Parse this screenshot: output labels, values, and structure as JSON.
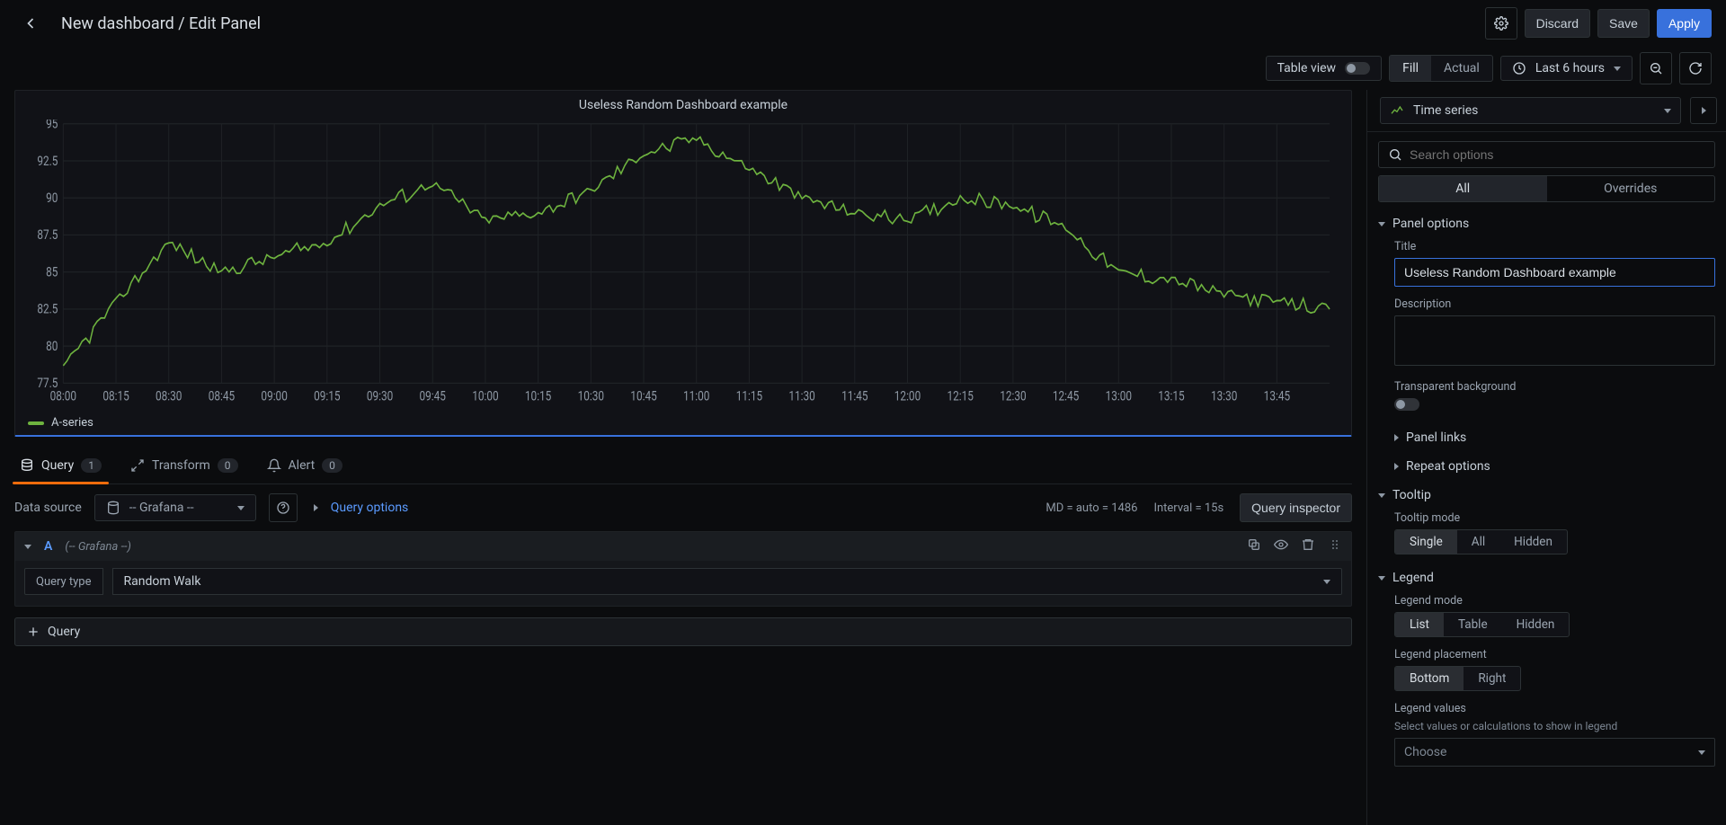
{
  "header": {
    "breadcrumb": "New dashboard / Edit Panel",
    "discard": "Discard",
    "save": "Save",
    "apply": "Apply"
  },
  "toolbar": {
    "table_view": "Table view",
    "fill": "Fill",
    "actual": "Actual",
    "time_range": "Last 6 hours"
  },
  "viz_picker": {
    "current": "Time series"
  },
  "chart": {
    "title": "Useless Random Dashboard example",
    "legend_series": "A-series"
  },
  "tabs": {
    "query": "Query",
    "query_count": "1",
    "transform": "Transform",
    "transform_count": "0",
    "alert": "Alert",
    "alert_count": "0"
  },
  "query": {
    "data_source_label": "Data source",
    "data_source_value": "-- Grafana --",
    "query_options": "Query options",
    "md": "MD = auto = 1486",
    "interval": "Interval = 15s",
    "inspector": "Query inspector",
    "row_letter": "A",
    "row_ds": "(-- Grafana --)",
    "query_type_label": "Query type",
    "query_type_value": "Random Walk",
    "add_query": "Query"
  },
  "side": {
    "search_placeholder": "Search options",
    "tab_all": "All",
    "tab_overrides": "Overrides",
    "panel_options": "Panel options",
    "title_label": "Title",
    "title_value": "Useless Random Dashboard example",
    "description_label": "Description",
    "transparent_label": "Transparent background",
    "panel_links": "Panel links",
    "repeat_options": "Repeat options",
    "tooltip": "Tooltip",
    "tooltip_mode_label": "Tooltip mode",
    "tooltip_mode": {
      "single": "Single",
      "all": "All",
      "hidden": "Hidden"
    },
    "legend": "Legend",
    "legend_mode_label": "Legend mode",
    "legend_mode": {
      "list": "List",
      "table": "Table",
      "hidden": "Hidden"
    },
    "legend_placement_label": "Legend placement",
    "legend_placement": {
      "bottom": "Bottom",
      "right": "Right"
    },
    "legend_values_label": "Legend values",
    "legend_values_hint": "Select values or calculations to show in legend",
    "legend_values_placeholder": "Choose"
  },
  "chart_data": {
    "type": "line",
    "title": "Useless Random Dashboard example",
    "xlabel": "",
    "ylabel": "",
    "ylim": [
      77.5,
      95
    ],
    "y_ticks": [
      77.5,
      80,
      82.5,
      85,
      87.5,
      90,
      92.5,
      95
    ],
    "x_ticks": [
      "08:00",
      "08:15",
      "08:30",
      "08:45",
      "09:00",
      "09:15",
      "09:30",
      "09:45",
      "10:00",
      "10:15",
      "10:30",
      "10:45",
      "11:00",
      "11:15",
      "11:30",
      "11:45",
      "12:00",
      "12:15",
      "12:30",
      "12:45",
      "13:00",
      "13:15",
      "13:30",
      "13:45"
    ],
    "series": [
      {
        "name": "A-series",
        "color": "#6eb33f",
        "x": [
          "08:00",
          "08:15",
          "08:30",
          "08:45",
          "09:00",
          "09:15",
          "09:30",
          "09:45",
          "10:00",
          "10:15",
          "10:30",
          "10:45",
          "11:00",
          "11:15",
          "11:30",
          "11:45",
          "12:00",
          "12:15",
          "12:30",
          "12:45",
          "13:00",
          "13:15",
          "13:30",
          "13:45",
          "14:00"
        ],
        "y": [
          78.5,
          83,
          87,
          85,
          86,
          87,
          89.5,
          91,
          88.5,
          89,
          90.5,
          93,
          94,
          92,
          90,
          89,
          88.5,
          90,
          89.5,
          88,
          85,
          84.5,
          83.5,
          83,
          82.5
        ]
      }
    ]
  }
}
